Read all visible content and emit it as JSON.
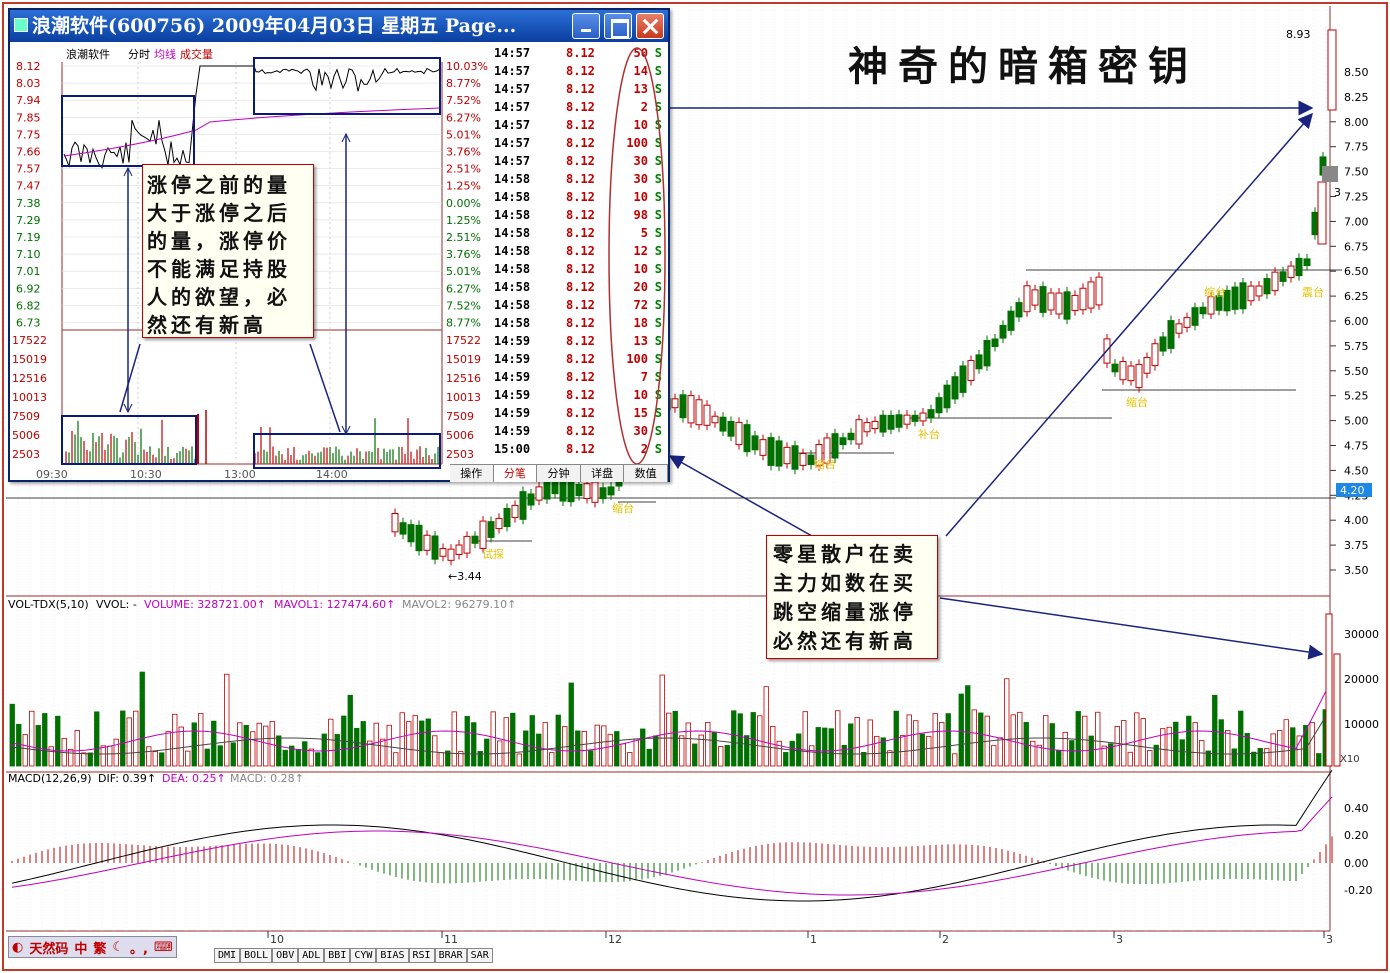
{
  "title": "神奇的暗箱密钥",
  "window": {
    "title": "浪潮软件(600756)  2009年04月03日  星期五  Page...",
    "legend": {
      "name": "浪潮软件",
      "mode": "分时",
      "avg": "均线",
      "vol": "成交量"
    },
    "price_labels": [
      "8.12",
      "8.03",
      "7.94",
      "7.85",
      "7.75",
      "7.66",
      "7.57",
      "7.47",
      "7.38",
      "7.29",
      "7.19",
      "7.10",
      "7.01",
      "6.92",
      "6.82",
      "6.73"
    ],
    "pct_labels": [
      "10.03%",
      "8.77%",
      "7.52%",
      "6.27%",
      "5.01%",
      "3.76%",
      "2.51%",
      "1.25%",
      "0.00%",
      "1.25%",
      "2.51%",
      "3.76%",
      "5.01%",
      "6.27%",
      "7.52%",
      "8.77%"
    ],
    "vol_labels": [
      "17522",
      "15019",
      "12516",
      "10013",
      "7509",
      "5006",
      "2503"
    ],
    "time_labels": [
      "09:30",
      "10:30",
      "13:00",
      "14:00"
    ],
    "trades": [
      {
        "t": "14:57",
        "p": "8.12",
        "v": "50",
        "s": "S"
      },
      {
        "t": "14:57",
        "p": "8.12",
        "v": "14",
        "s": "S"
      },
      {
        "t": "14:57",
        "p": "8.12",
        "v": "13",
        "s": "S"
      },
      {
        "t": "14:57",
        "p": "8.12",
        "v": "2",
        "s": "S"
      },
      {
        "t": "14:57",
        "p": "8.12",
        "v": "10",
        "s": "S"
      },
      {
        "t": "14:57",
        "p": "8.12",
        "v": "100",
        "s": "S"
      },
      {
        "t": "14:57",
        "p": "8.12",
        "v": "30",
        "s": "S"
      },
      {
        "t": "14:58",
        "p": "8.12",
        "v": "30",
        "s": "S"
      },
      {
        "t": "14:58",
        "p": "8.12",
        "v": "10",
        "s": "S"
      },
      {
        "t": "14:58",
        "p": "8.12",
        "v": "98",
        "s": "S"
      },
      {
        "t": "14:58",
        "p": "8.12",
        "v": "5",
        "s": "S"
      },
      {
        "t": "14:58",
        "p": "8.12",
        "v": "12",
        "s": "S"
      },
      {
        "t": "14:58",
        "p": "8.12",
        "v": "10",
        "s": "S"
      },
      {
        "t": "14:58",
        "p": "8.12",
        "v": "20",
        "s": "S"
      },
      {
        "t": "14:58",
        "p": "8.12",
        "v": "72",
        "s": "S"
      },
      {
        "t": "14:58",
        "p": "8.12",
        "v": "18",
        "s": "S"
      },
      {
        "t": "14:59",
        "p": "8.12",
        "v": "13",
        "s": "S"
      },
      {
        "t": "14:59",
        "p": "8.12",
        "v": "100",
        "s": "S"
      },
      {
        "t": "14:59",
        "p": "8.12",
        "v": "7",
        "s": "S"
      },
      {
        "t": "14:59",
        "p": "8.12",
        "v": "10",
        "s": "S"
      },
      {
        "t": "14:59",
        "p": "8.12",
        "v": "15",
        "s": "S"
      },
      {
        "t": "14:59",
        "p": "8.12",
        "v": "30",
        "s": "S"
      },
      {
        "t": "15:00",
        "p": "8.12",
        "v": "2",
        "s": "S"
      }
    ],
    "tabs": [
      "操作",
      "分笔",
      "分钟",
      "详盘",
      "数值"
    ],
    "callout": [
      "涨停之前的量",
      "大于涨停之后",
      "的量，涨停价",
      "不能满足持股",
      "人的欲望，必",
      "然还有新高"
    ]
  },
  "callout2": [
    "零星散户在卖",
    "主力如数在买",
    "跳空缩量涨停",
    "必然还有新高"
  ],
  "chart": {
    "price_axis": [
      "8.50",
      "8.25",
      "8.00",
      "7.75",
      "7.50",
      "7.25",
      "7.00",
      "6.75",
      "6.50",
      "6.25",
      "6.00",
      "5.75",
      "5.50",
      "5.25",
      "5.00",
      "4.75",
      "4.50",
      "4.25",
      "4.00",
      "3.75",
      "3.50"
    ],
    "current_price": "4.20",
    "high_label": "8.93",
    "low_label": "←3.44",
    "side_label": "3",
    "annotations": [
      "试探",
      "缩台",
      "缩台",
      "补台",
      "缩台",
      "震台",
      "缩台"
    ],
    "vol_header": {
      "name": "VOL-TDX(5,10)",
      "vvol": "VVOL: -",
      "volume": "VOLUME: 328721.00↑",
      "mavol1": "MAVOL1: 127474.60↑",
      "mavol2": "MAVOL2: 96279.10↑"
    },
    "vol_axis": [
      "30000",
      "20000",
      "10000"
    ],
    "vol_unit": "X10",
    "macd_header": {
      "name": "MACD(12,26,9)",
      "dif": "DIF: 0.39↑",
      "dea": "DEA: 0.25↑",
      "macd": "MACD: 0.28↑"
    },
    "macd_axis": [
      "0.40",
      "0.20",
      "0.00",
      "-0.20"
    ],
    "x_labels": [
      "10",
      "11",
      "12",
      "1",
      "2",
      "3",
      "3"
    ]
  },
  "ime": [
    "天然码",
    "中",
    "繁"
  ],
  "indicator_tabs": [
    "DMI",
    "BOLL",
    "OBV",
    "ADL",
    "BBI",
    "CYW",
    "BIAS",
    "RSI",
    "BRAR",
    "SAR"
  ]
}
